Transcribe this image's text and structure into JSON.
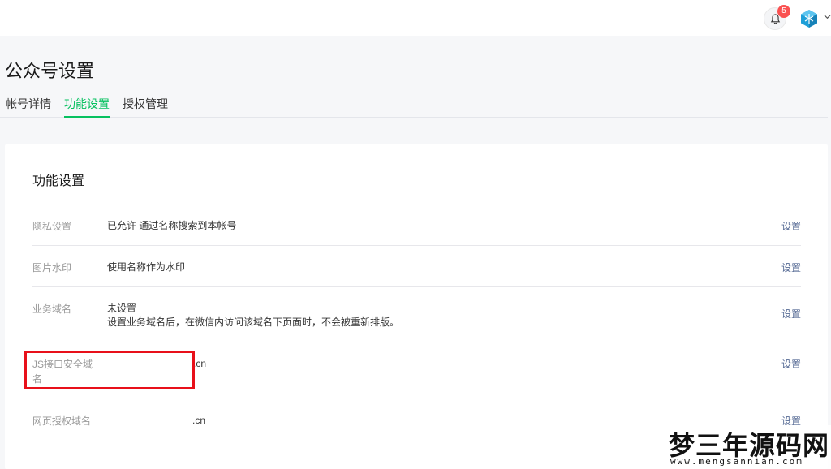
{
  "header": {
    "notification_count": "5",
    "bell_icon": "bell-icon",
    "avatar_icon": "cube-avatar-icon",
    "dropdown_icon": "chevron-down-icon"
  },
  "page": {
    "title": "公众号设置",
    "tabs": [
      {
        "label": "帐号详情",
        "active": false
      },
      {
        "label": "功能设置",
        "active": true
      },
      {
        "label": "授权管理",
        "active": false
      }
    ]
  },
  "card": {
    "title": "功能设置",
    "rows": [
      {
        "label": "隐私设置",
        "value": "已允许 通过名称搜索到本帐号",
        "action": "设置"
      },
      {
        "label": "图片水印",
        "value": "使用名称作为水印",
        "action": "设置"
      },
      {
        "label": "业务域名",
        "value": "未设置",
        "desc": "设置业务域名后，在微信内访问该域名下页面时，不会被重新排版。",
        "action": "设置"
      },
      {
        "label": "JS接口安全域名",
        "value": ".cn",
        "action": "设置"
      },
      {
        "label": "网页授权域名",
        "value": ".cn",
        "action": "设置"
      }
    ]
  },
  "watermark": {
    "text": "梦三年源码网",
    "url": "www.mengsannian.com"
  },
  "colors": {
    "accent": "#07c160",
    "link": "#576b95",
    "highlight": "#e8101a",
    "badge": "#fa5151"
  }
}
